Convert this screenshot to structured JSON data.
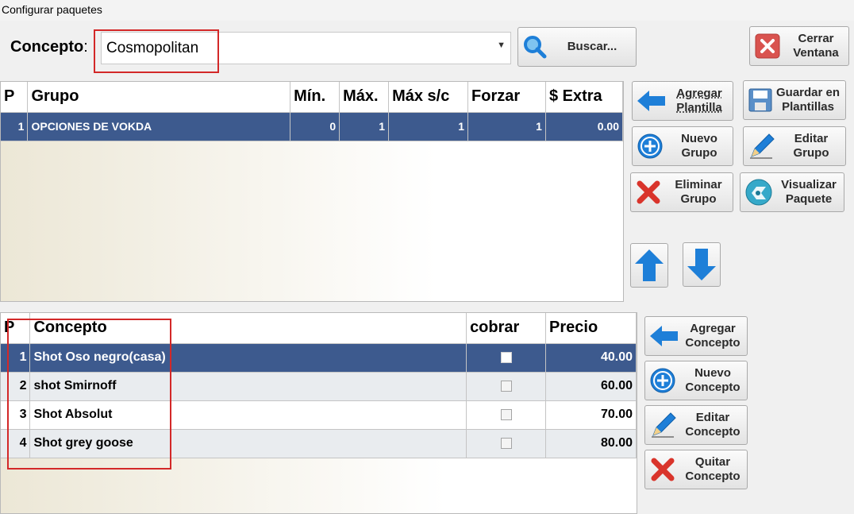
{
  "window": {
    "title": "Configurar paquetes"
  },
  "header": {
    "concepto_label": "Concepto",
    "concepto_colon": ":",
    "concepto_value": "Cosmopolitan",
    "buscar_label": "Buscar...",
    "cerrar_label": "Cerrar\nVentana"
  },
  "group_actions": {
    "agregar_plantilla": "Agregar\nPlantilla",
    "guardar_plantillas": "Guardar en\nPlantillas",
    "nuevo_grupo": "Nuevo\nGrupo",
    "editar_grupo": "Editar\nGrupo",
    "eliminar_grupo": "Eliminar\nGrupo",
    "visualizar_paquete": "Visualizar\nPaquete"
  },
  "groups_table": {
    "columns": [
      "P",
      "Grupo",
      "Mín.",
      "Máx.",
      "Máx s/c",
      "Forzar",
      "$ Extra"
    ],
    "rows": [
      {
        "p": "1",
        "grupo": "OPCIONES DE VOKDA",
        "min": "0",
        "max": "1",
        "max_sc": "1",
        "forzar": "1",
        "extra": "0.00"
      }
    ]
  },
  "concept_actions": {
    "agregar_concepto": "Agregar\nConcepto",
    "nuevo_concepto": "Nuevo\nConcepto",
    "editar_concepto": "Editar\nConcepto",
    "quitar_concepto": "Quitar\nConcepto"
  },
  "concepts_table": {
    "columns": [
      "P",
      "Concepto",
      "cobrar",
      "Precio"
    ],
    "rows": [
      {
        "p": "1",
        "concepto": "Shot Oso negro(casa)",
        "cobrar": false,
        "precio": "40.00"
      },
      {
        "p": "2",
        "concepto": "shot Smirnoff",
        "cobrar": false,
        "precio": "60.00"
      },
      {
        "p": "3",
        "concepto": "Shot Absolut",
        "cobrar": false,
        "precio": "70.00"
      },
      {
        "p": "4",
        "concepto": "Shot grey goose",
        "cobrar": false,
        "precio": "80.00"
      }
    ]
  },
  "colors": {
    "selected_row": "#3d5a8e",
    "accent_blue": "#1e7fd8",
    "highlight_red": "#d32828"
  }
}
